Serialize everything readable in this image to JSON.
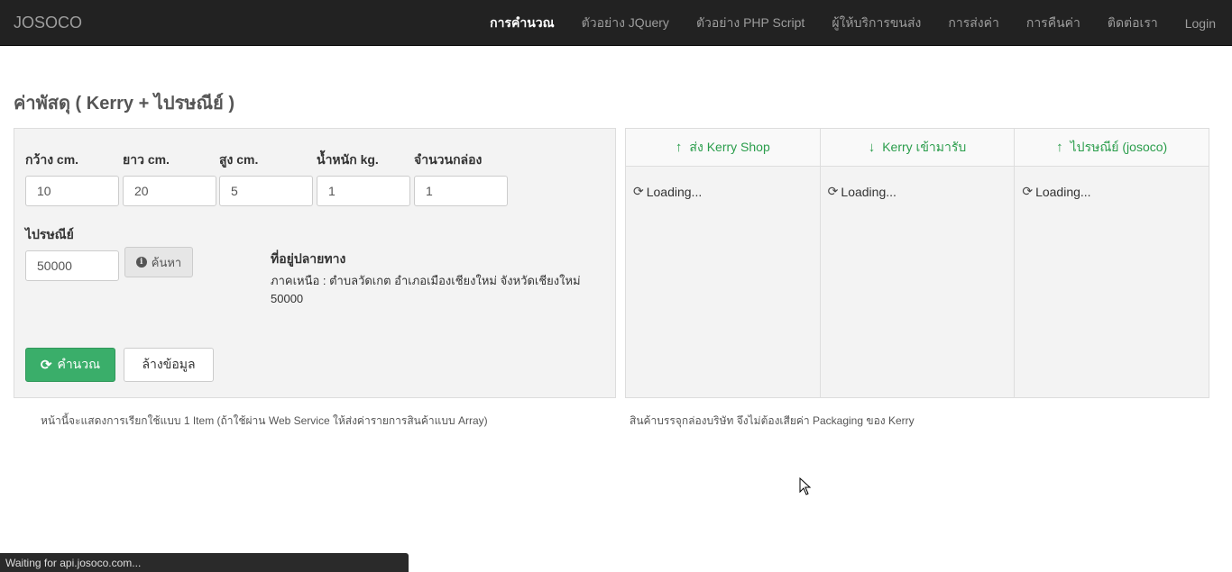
{
  "navbar": {
    "brand": "JOSOCO",
    "items": [
      {
        "label": "การคำนวณ",
        "active": true
      },
      {
        "label": "ตัวอย่าง JQuery"
      },
      {
        "label": "ตัวอย่าง PHP Script"
      },
      {
        "label": "ผู้ให้บริการขนส่ง"
      },
      {
        "label": "การส่งค่า"
      },
      {
        "label": "การคืนค่า"
      },
      {
        "label": "ติดต่อเรา"
      },
      {
        "label": "Login"
      }
    ]
  },
  "page": {
    "title": "ค่าพัสดุ ( Kerry + ไปรษณีย์ )"
  },
  "form": {
    "width": {
      "label": "กว้าง cm.",
      "value": "10"
    },
    "length": {
      "label": "ยาว cm.",
      "value": "20"
    },
    "height": {
      "label": "สูง cm.",
      "value": "5"
    },
    "weight": {
      "label": "น้ำหนัก kg.",
      "value": "1"
    },
    "boxes": {
      "label": "จำนวนกล่อง",
      "value": "1"
    },
    "postcode": {
      "label": "ไปรษณีย์",
      "value": "50000"
    },
    "search_label": "ค้นหา",
    "address_title": "ที่อยู่ปลายทาง",
    "address_text": "ภาคเหนือ : ตำบลวัดเกต อำเภอเมืองเชียงใหม่ จังหวัดเชียงใหม่ 50000",
    "calc_label": "คำนวณ",
    "clear_label": "ล้างข้อมูล"
  },
  "results": {
    "columns": [
      {
        "title": "ส่ง Kerry Shop",
        "direction": "up",
        "status": "Loading..."
      },
      {
        "title": "Kerry เข้ามารับ",
        "direction": "down",
        "status": "Loading..."
      },
      {
        "title": "ไปรษณีย์ (josoco)",
        "direction": "up",
        "status": "Loading..."
      }
    ]
  },
  "notes": {
    "left": "หน้านี้จะแสดงการเรียกใช้แบบ 1 Item (ถ้าใช้ผ่าน Web Service ให้ส่งค่ารายการสินค้าแบบ Array)",
    "right": "สินค้าบรรจุกล่องบริษัท จึงไม่ต้องเสียค่า Packaging ของ Kerry"
  },
  "status_bar": "Waiting for api.josoco.com...",
  "colors": {
    "accent_green": "#3aae6a",
    "header_text_green": "#2a9d4b",
    "navbar_bg": "#222222"
  }
}
